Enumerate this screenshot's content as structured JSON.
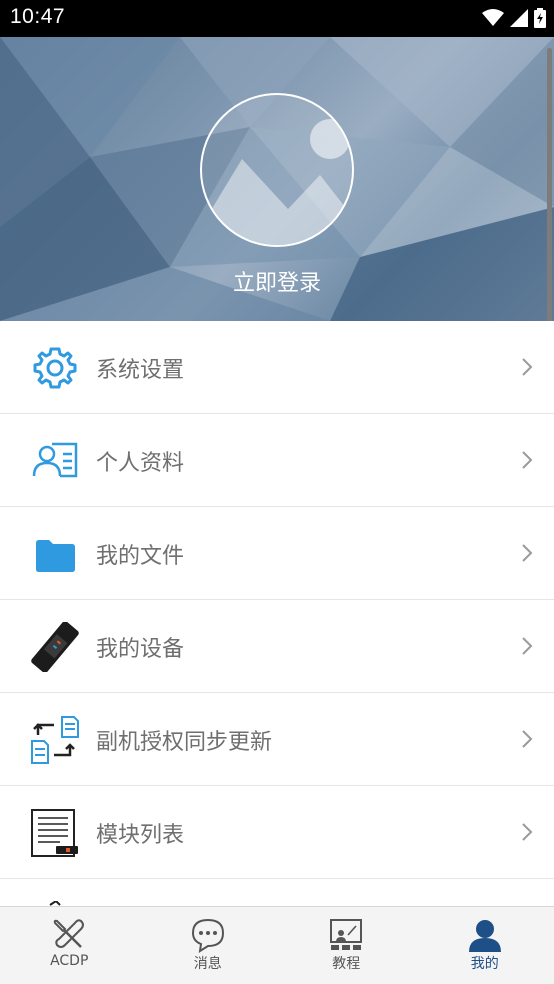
{
  "status_bar": {
    "time": "10:47"
  },
  "header": {
    "login_label": "立即登录"
  },
  "menu": {
    "items": [
      {
        "label": "系统设置",
        "icon": "gear-icon"
      },
      {
        "label": "个人资料",
        "icon": "profile-card-icon"
      },
      {
        "label": "我的文件",
        "icon": "folder-icon"
      },
      {
        "label": "我的设备",
        "icon": "device-icon"
      },
      {
        "label": "副机授权同步更新",
        "icon": "sync-documents-icon"
      },
      {
        "label": "模块列表",
        "icon": "module-list-icon"
      }
    ]
  },
  "bottom_nav": {
    "items": [
      {
        "label": "ACDP",
        "icon": "tools-icon"
      },
      {
        "label": "消息",
        "icon": "chat-bubble-icon"
      },
      {
        "label": "教程",
        "icon": "classroom-icon"
      },
      {
        "label": "我的",
        "icon": "person-icon",
        "active": true
      }
    ]
  },
  "colors": {
    "accent": "#1e4f86",
    "icon_blue": "#2f9ae0",
    "text_gray": "#6f6f6f"
  }
}
